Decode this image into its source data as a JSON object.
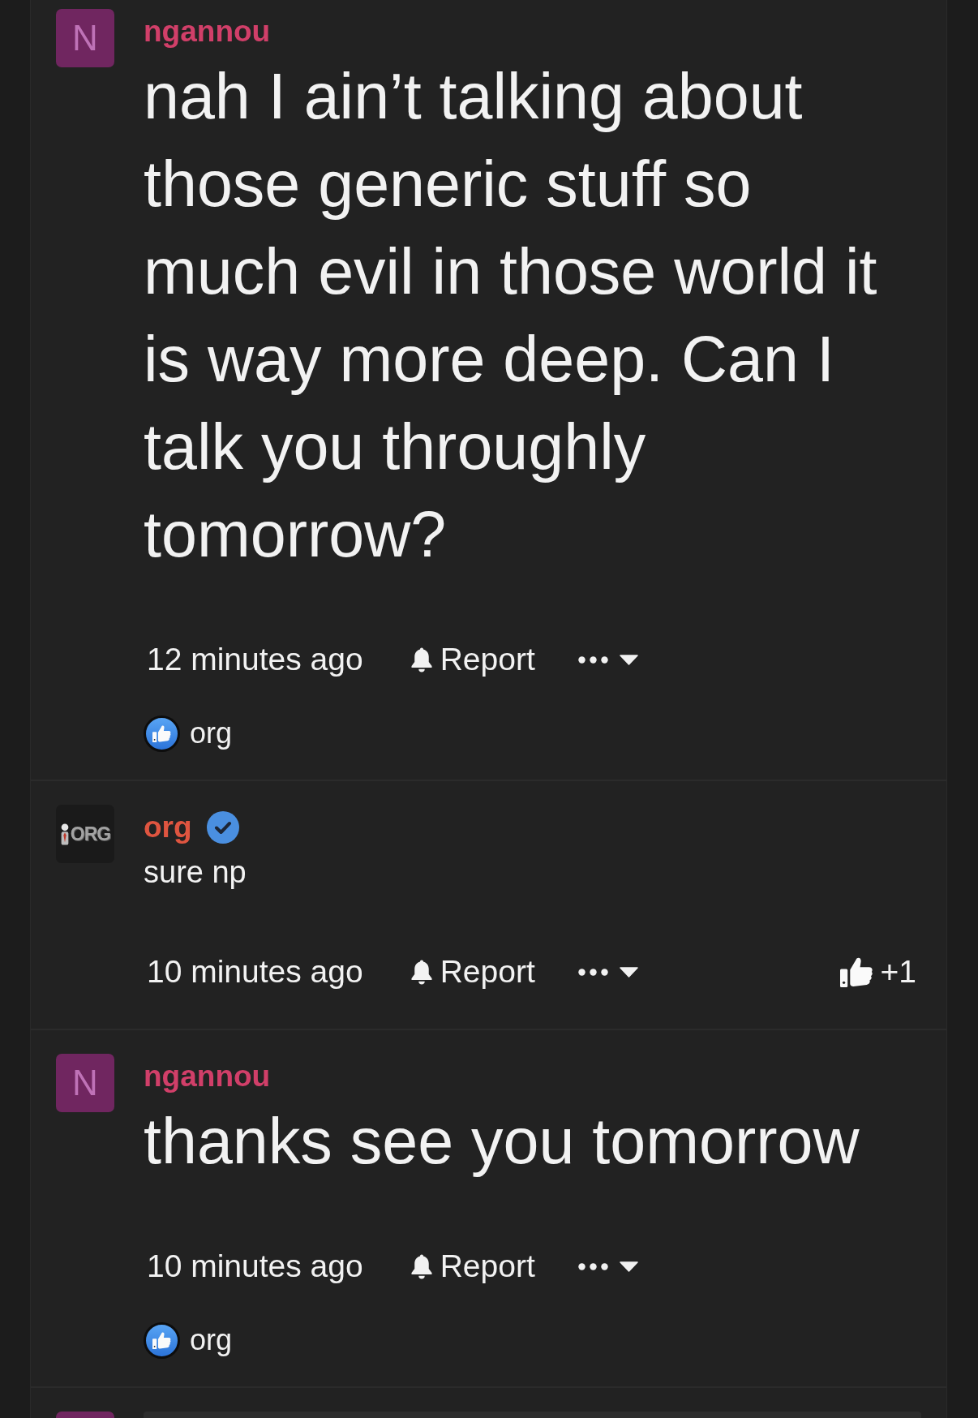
{
  "comments": [
    {
      "kind": "large",
      "author": {
        "name": "ngannou",
        "color": "#d13f69",
        "verified": false,
        "avatar": {
          "kind": "letter",
          "letter": "N",
          "color": "#702660"
        }
      },
      "text": "nah I ain’t talking about those generic stuff so much evil in those world it is way more deep. Can I talk you throughly tomorrow?",
      "time": "12 minutes ago",
      "report": "Report",
      "likes": [
        {
          "name": "org"
        }
      ]
    },
    {
      "kind": "plain",
      "author": {
        "name": "org",
        "color": "#df5540",
        "verified": true,
        "avatar": {
          "kind": "logo",
          "text": "ORG"
        }
      },
      "text": "sure np",
      "time": "10 minutes ago",
      "report": "Report",
      "vote": "+1"
    },
    {
      "kind": "large",
      "author": {
        "name": "ngannou",
        "color": "#d13f69",
        "verified": false,
        "avatar": {
          "kind": "letter",
          "letter": "N",
          "color": "#702660"
        }
      },
      "text": "thanks see you tomorrow",
      "time": "10 minutes ago",
      "report": "Report",
      "likes": [
        {
          "name": "org"
        }
      ]
    }
  ],
  "next_comment": {
    "avatar": {
      "kind": "letter",
      "color": "#702660"
    },
    "block": true
  }
}
